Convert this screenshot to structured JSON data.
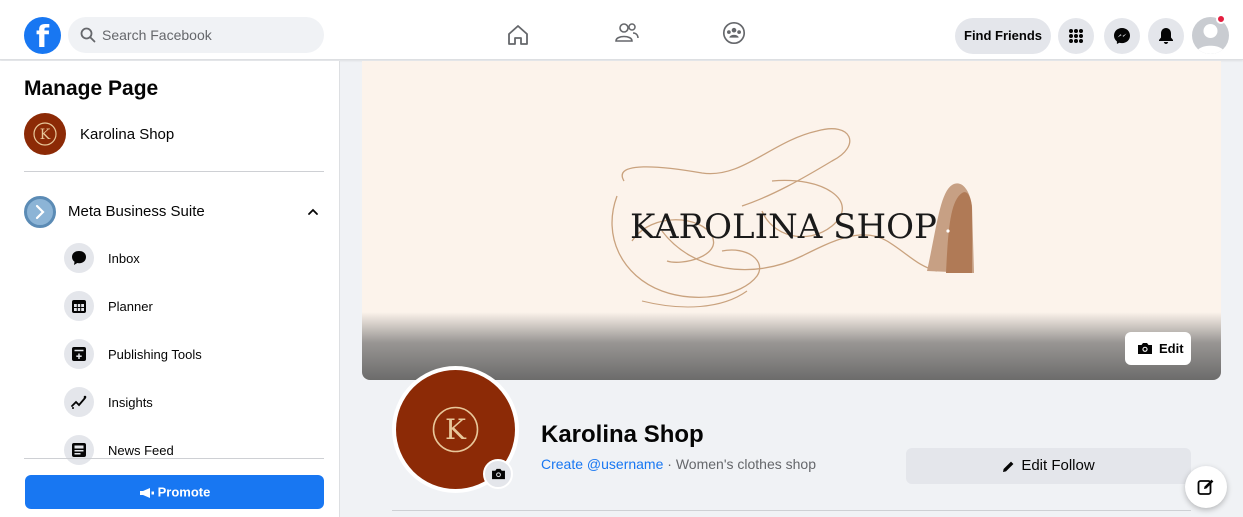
{
  "topbar": {
    "search_placeholder": "Search Facebook",
    "find_friends_label": "Find Friends",
    "icons": [
      "facebook-logo",
      "search-icon",
      "home-icon",
      "friends-icon",
      "groups-icon",
      "menu-grid-icon",
      "messenger-icon",
      "notifications-icon",
      "account-avatar"
    ],
    "notification_dot_color": "#e41e3f"
  },
  "sidebar": {
    "title": "Manage Page",
    "page_name": "Karolina Shop",
    "suite_label": "Meta Business Suite",
    "items": [
      {
        "label": "Inbox",
        "icon": "chat-bubble-icon"
      },
      {
        "label": "Planner",
        "icon": "calendar-icon"
      },
      {
        "label": "Publishing Tools",
        "icon": "publishing-tools-icon"
      },
      {
        "label": "Insights",
        "icon": "insights-icon"
      },
      {
        "label": "News Feed",
        "icon": "news-feed-icon"
      }
    ],
    "promote_label": "Promote"
  },
  "cover": {
    "title_text": "KAROLINA SHOP",
    "edit_label": "Edit"
  },
  "profile": {
    "page_name": "Karolina Shop",
    "create_username_link": "Create @username",
    "separator": " · ",
    "category": "Women's clothes shop",
    "edit_follow_label": "Edit Follow",
    "logo_letter": "K"
  },
  "colors": {
    "brand_blue": "#1877f2",
    "logo_brown": "#8c2a06",
    "gold": "#e8c79a",
    "cover_bg": "#fcf3eb"
  }
}
